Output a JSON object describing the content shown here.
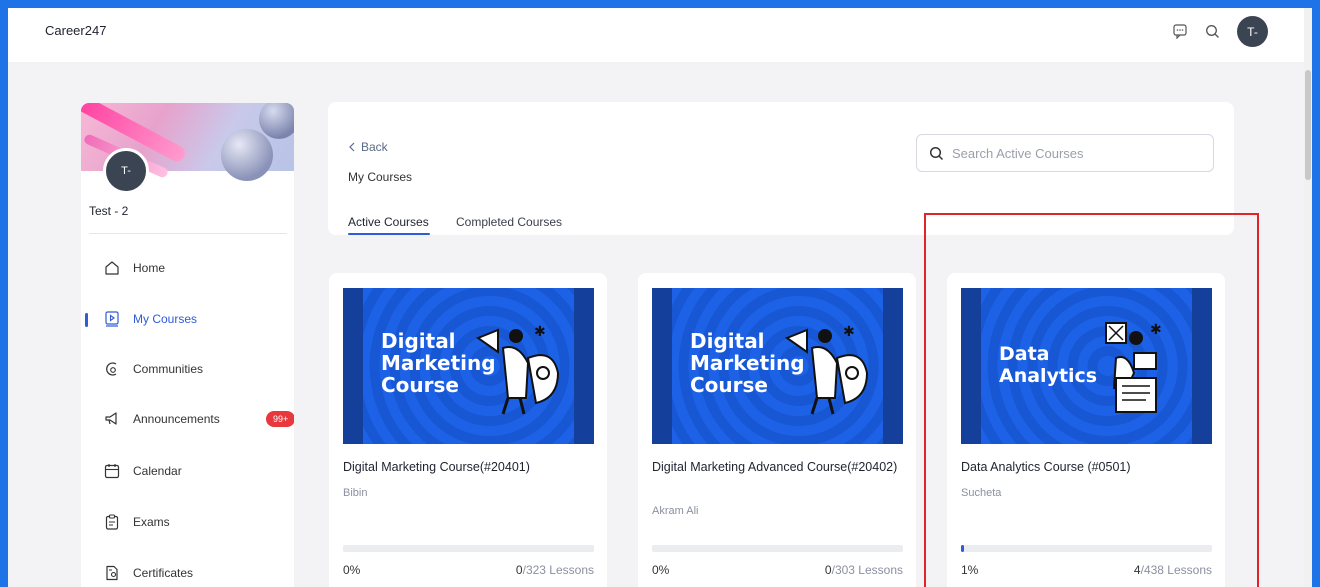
{
  "app": {
    "brand": "Career247",
    "avatar_initials": "T-"
  },
  "topbar": {
    "icons": [
      "chat-icon",
      "search-icon"
    ]
  },
  "sidebar": {
    "avatar_initials": "T-",
    "user_name": "Test - 2",
    "items": [
      {
        "label": "Home",
        "icon": "home-icon",
        "active": false
      },
      {
        "label": "My Courses",
        "icon": "play-square-icon",
        "active": true
      },
      {
        "label": "Communities",
        "icon": "communities-icon",
        "active": false
      },
      {
        "label": "Announcements",
        "icon": "megaphone-icon",
        "active": false,
        "badge": "99+"
      },
      {
        "label": "Calendar",
        "icon": "calendar-icon",
        "active": false
      },
      {
        "label": "Exams",
        "icon": "clipboard-icon",
        "active": false
      },
      {
        "label": "Certificates",
        "icon": "certificate-icon",
        "active": false
      }
    ]
  },
  "header": {
    "back_label": "Back",
    "title": "My Courses",
    "search_placeholder": "Search Active Courses",
    "tabs": [
      {
        "label": "Active Courses",
        "active": true
      },
      {
        "label": "Completed Courses",
        "active": false
      }
    ]
  },
  "courses": [
    {
      "thumb_text": "Digital\nMarketing\nCourse",
      "name": "Digital Marketing Course(#20401)",
      "instructor": "Bibin",
      "progress_pct": 0,
      "progress_label": "0%",
      "lessons_done": "0",
      "lessons_total": "/323 Lessons"
    },
    {
      "thumb_text": "Digital\nMarketing\nCourse",
      "name": "Digital Marketing Advanced Course(#20402)",
      "instructor": "Akram Ali",
      "progress_pct": 0,
      "progress_label": "0%",
      "lessons_done": "0",
      "lessons_total": "/303 Lessons"
    },
    {
      "thumb_text": "Data\nAnalytics",
      "name": "Data Analytics Course (#0501)",
      "instructor": "Sucheta",
      "progress_pct": 1,
      "progress_label": "1%",
      "lessons_done": "4",
      "lessons_total": "/438 Lessons"
    }
  ],
  "colors": {
    "accent": "#2f5bd8",
    "badge": "#e8383d",
    "highlight": "#e0242a",
    "thumb_bg": "#1a5ad8"
  }
}
